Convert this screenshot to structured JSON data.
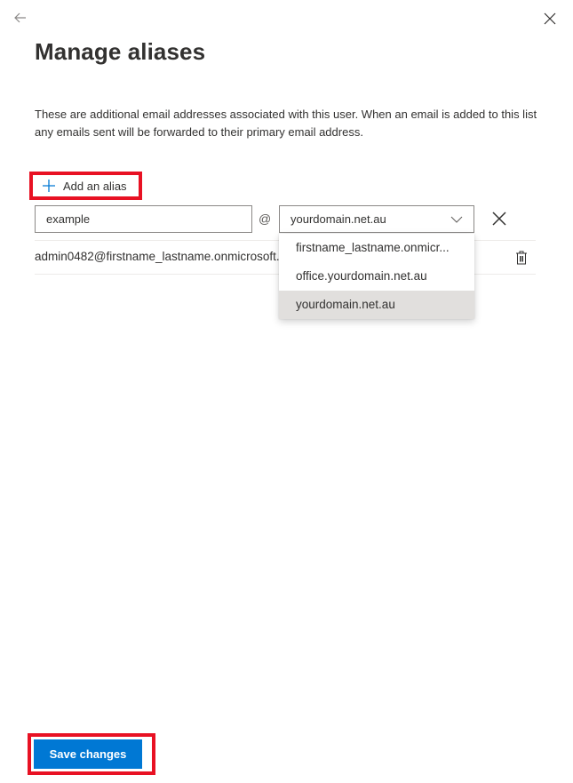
{
  "header": {
    "back_icon": "arrow-left-icon",
    "close_icon": "close-icon",
    "title": "Manage aliases"
  },
  "description": "These are additional email addresses associated with this user. When an email is added to this list any emails sent will be forwarded to their primary email address.",
  "add_alias": {
    "icon": "plus-icon",
    "label": "Add an alias"
  },
  "new_alias": {
    "username_value": "example",
    "at_symbol": "@",
    "domain_selected": "yourdomain.net.au",
    "domain_options": [
      "firstname_lastname.onmicr...",
      "office.yourdomain.net.au",
      "yourdomain.net.au"
    ],
    "selected_index": 2
  },
  "aliases": [
    {
      "email": "admin0482@firstname_lastname.onmicrosoft.com"
    }
  ],
  "footer": {
    "save_label": "Save changes"
  },
  "colors": {
    "accent": "#0078d4",
    "highlight_border": "#e81123"
  }
}
